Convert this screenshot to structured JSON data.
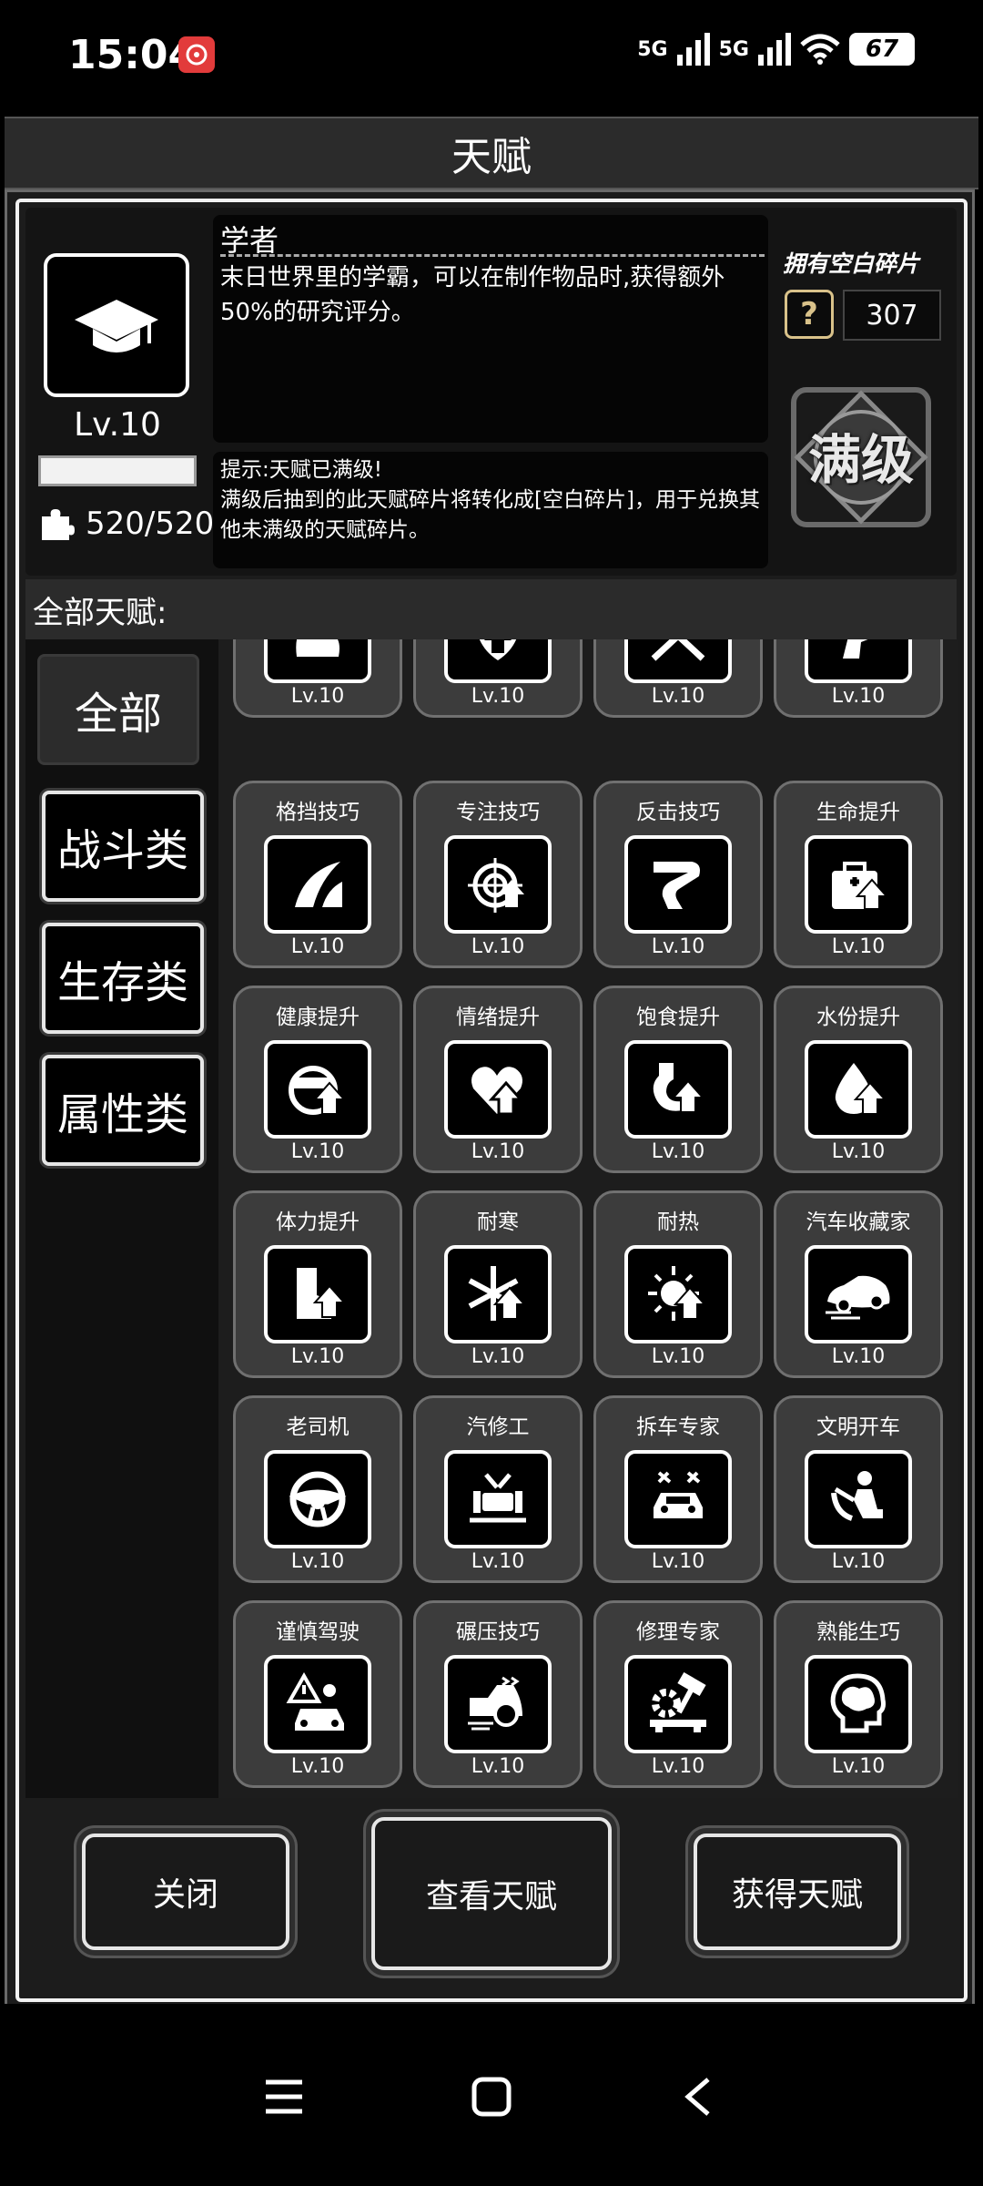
{
  "status_bar": {
    "time": "15:04",
    "network_1": "5G",
    "network_2": "5G",
    "battery": "67"
  },
  "title": "天赋",
  "selected_talent": {
    "name": "学者",
    "level": "Lv.10",
    "level_progress": 1.0,
    "description": "末日世界里的学霸，可以在制作物品时,获得额外50%的研究评分。",
    "fragments": "520/520",
    "hint": "提示:天赋已满级!\n满级后抽到的此天赋碎片将转化成[空白碎片]，用于兑换其他未满级的天赋碎片。",
    "max_badge": "满级"
  },
  "blank_fragments": {
    "label": "拥有空白碎片",
    "count": "307"
  },
  "all_talents_label": "全部天赋:",
  "categories": [
    {
      "label": "全部",
      "active": true
    },
    {
      "label": "战斗类",
      "active": false
    },
    {
      "label": "生存类",
      "active": false
    },
    {
      "label": "属性类",
      "active": false
    }
  ],
  "talents": [
    {
      "name": "",
      "level": "Lv.10",
      "icon": "muscle-icon"
    },
    {
      "name": "",
      "level": "Lv.10",
      "icon": "shield-up-icon"
    },
    {
      "name": "",
      "level": "Lv.10",
      "icon": "crossed-swords-icon"
    },
    {
      "name": "",
      "level": "Lv.10",
      "icon": "dash-icon"
    },
    {
      "name": "格挡技巧",
      "level": "Lv.10",
      "icon": "block-icon"
    },
    {
      "name": "专注技巧",
      "level": "Lv.10",
      "icon": "crosshair-up-icon"
    },
    {
      "name": "反击技巧",
      "level": "Lv.10",
      "icon": "counter-arm-icon"
    },
    {
      "name": "生命提升",
      "level": "Lv.10",
      "icon": "medkit-up-icon"
    },
    {
      "name": "健康提升",
      "level": "Lv.10",
      "icon": "health-up-icon"
    },
    {
      "name": "情绪提升",
      "level": "Lv.10",
      "icon": "heart-up-icon"
    },
    {
      "name": "饱食提升",
      "level": "Lv.10",
      "icon": "stomach-up-icon"
    },
    {
      "name": "水份提升",
      "level": "Lv.10",
      "icon": "water-drop-up-icon"
    },
    {
      "name": "体力提升",
      "level": "Lv.10",
      "icon": "boot-up-icon"
    },
    {
      "name": "耐寒",
      "level": "Lv.10",
      "icon": "snowflake-up-icon"
    },
    {
      "name": "耐热",
      "level": "Lv.10",
      "icon": "sun-up-icon"
    },
    {
      "name": "汽车收藏家",
      "level": "Lv.10",
      "icon": "sports-car-icon"
    },
    {
      "name": "老司机",
      "level": "Lv.10",
      "icon": "steering-wheel-icon"
    },
    {
      "name": "汽修工",
      "level": "Lv.10",
      "icon": "car-lift-icon"
    },
    {
      "name": "拆车专家",
      "level": "Lv.10",
      "icon": "car-tools-icon"
    },
    {
      "name": "文明开车",
      "level": "Lv.10",
      "icon": "driver-seat-icon"
    },
    {
      "name": "谨慎驾驶",
      "level": "Lv.10",
      "icon": "warning-car-icon"
    },
    {
      "name": "碾压技巧",
      "level": "Lv.10",
      "icon": "speeding-car-icon"
    },
    {
      "name": "修理专家",
      "level": "Lv.10",
      "icon": "gear-hammer-icon"
    },
    {
      "name": "熟能生巧",
      "level": "Lv.10",
      "icon": "brain-head-icon"
    }
  ],
  "buttons": {
    "close": "关闭",
    "view": "查看天赋",
    "obtain": "获得天赋"
  }
}
